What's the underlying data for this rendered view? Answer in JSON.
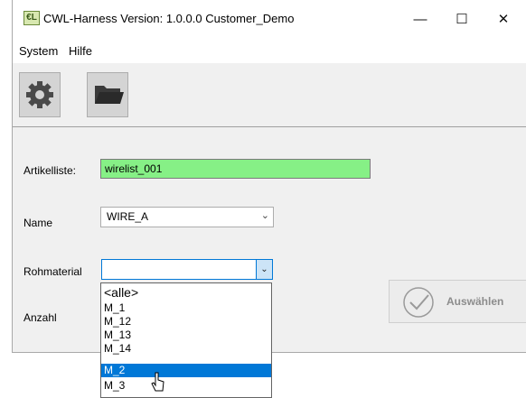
{
  "window": {
    "title": "CWL-Harness  Version: 1.0.0.0  Customer_Demo",
    "app_icon_text": "€L",
    "minimize_glyph": "—",
    "maximize_glyph": "☐",
    "close_glyph": "✕"
  },
  "menu": {
    "items": [
      "System",
      "Hilfe"
    ]
  },
  "toolbar": {
    "settings_icon": "gear-icon",
    "open_icon": "folder-icon"
  },
  "form": {
    "artikelliste_label": "Artikelliste:",
    "artikelliste_value": "wirelist_001",
    "name_label": "Name",
    "name_value": "WIRE_A",
    "rohmaterial_label": "Rohmaterial",
    "rohmaterial_value": "",
    "anzahl_label": "Anzahl"
  },
  "dropdown": {
    "options": [
      "<alle>",
      "M_1",
      "M_12",
      "M_13",
      "M_14",
      "M_2",
      "M_3"
    ],
    "selected": "M_2"
  },
  "select_button": {
    "label": "Auswählen",
    "enabled": false
  },
  "colors": {
    "highlight_field": "#86f086",
    "selection": "#0078d7"
  }
}
